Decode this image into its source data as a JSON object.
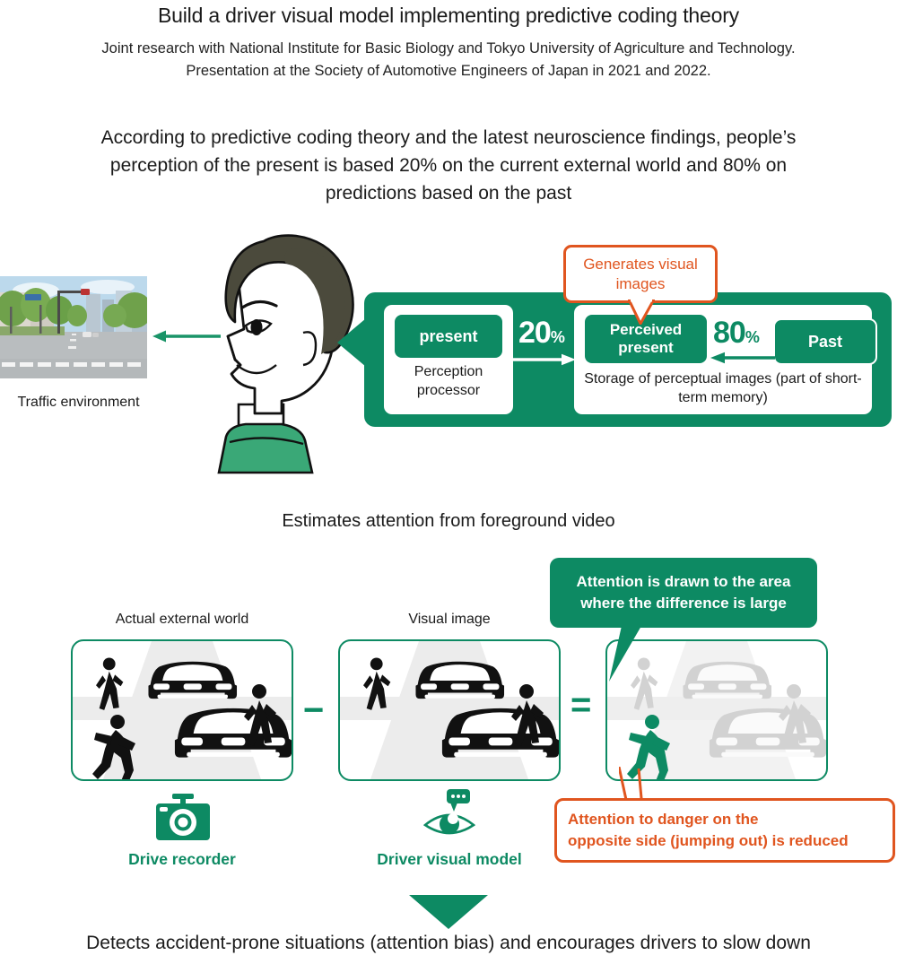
{
  "header": {
    "title": "Build a driver visual model implementing predictive coding theory",
    "subtitle": "Joint research with National Institute for Basic Biology and Tokyo University of Agriculture and Technology. Presentation at the Society of Automotive Engineers of Japan in 2021 and 2022.",
    "lede": "According to predictive coding theory and the latest neuroscience findings, people’s perception of the present is based 20% on the current external world and 80% on predictions based on the past"
  },
  "top_diagram": {
    "traffic_label": "Traffic environment",
    "present_chip": "present",
    "present_caption": "Perception processor",
    "perceived_chip": "Perceived present",
    "memory_caption": "Storage of perceptual images (part of short-term memory)",
    "past_chip": "Past",
    "percent_external": "20",
    "percent_past": "80",
    "percent_symbol": "%",
    "callout_generates": "Generates visual images"
  },
  "middle": {
    "estimates_label": "Estimates attention from foreground video"
  },
  "bottom": {
    "panel_actual_label": "Actual external world",
    "panel_visual_label": "Visual image",
    "operator_minus": "−",
    "operator_equals": "=",
    "callout_attention": "Attention is drawn to the area where the difference is large",
    "callout_reduced_line1": "Attention to danger on the",
    "callout_reduced_line2": "opposite side (jumping out) is reduced",
    "caption_recorder": "Drive recorder",
    "caption_model": "Driver visual model"
  },
  "footer": {
    "text": "Detects accident-prone situations (attention bias) and encourages drivers to slow down"
  },
  "colors": {
    "brand_green": "#0d8a63",
    "accent_orange": "#e0551f",
    "figure_black": "#111111",
    "figure_gray": "#d2d2d2",
    "road_gray": "#ececec",
    "text_dark": "#1a1a1a"
  },
  "icons": {
    "eye_arrow": "arrow-left-icon",
    "green_arrow_tail": "arrow-left-icon",
    "drive_recorder": "dashcam-camera-icon",
    "driver_model": "eye-speech-icon",
    "down_arrow": "triangle-down-icon"
  }
}
